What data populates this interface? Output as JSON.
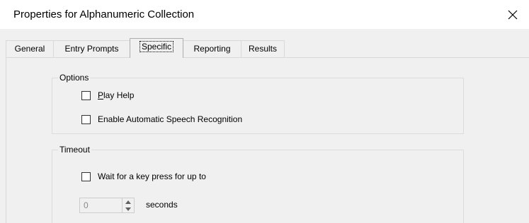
{
  "window": {
    "title": "Properties for Alphanumeric Collection",
    "close_icon": "close-icon"
  },
  "tabs": [
    {
      "label": "General",
      "active": false
    },
    {
      "label": "Entry Prompts",
      "active": false
    },
    {
      "label": "Specific",
      "active": true
    },
    {
      "label": "Reporting",
      "active": false
    },
    {
      "label": "Results",
      "active": false
    }
  ],
  "options": {
    "group_label": "Options",
    "play_help": {
      "prefix": "",
      "underlined": "P",
      "rest": "lay Help",
      "checked": false
    },
    "enable_asr": {
      "label": "Enable Automatic Speech Recognition",
      "checked": false
    }
  },
  "timeout": {
    "group_label": "Timeout",
    "wait_key": {
      "label": "Wait for a key press for up to",
      "checked": false
    },
    "seconds_value": "0",
    "seconds_label": "seconds"
  },
  "colors": {
    "dialog_bg": "#f0f0f0",
    "title_bg": "#ffffff",
    "disabled_text": "#8a8a8a"
  }
}
